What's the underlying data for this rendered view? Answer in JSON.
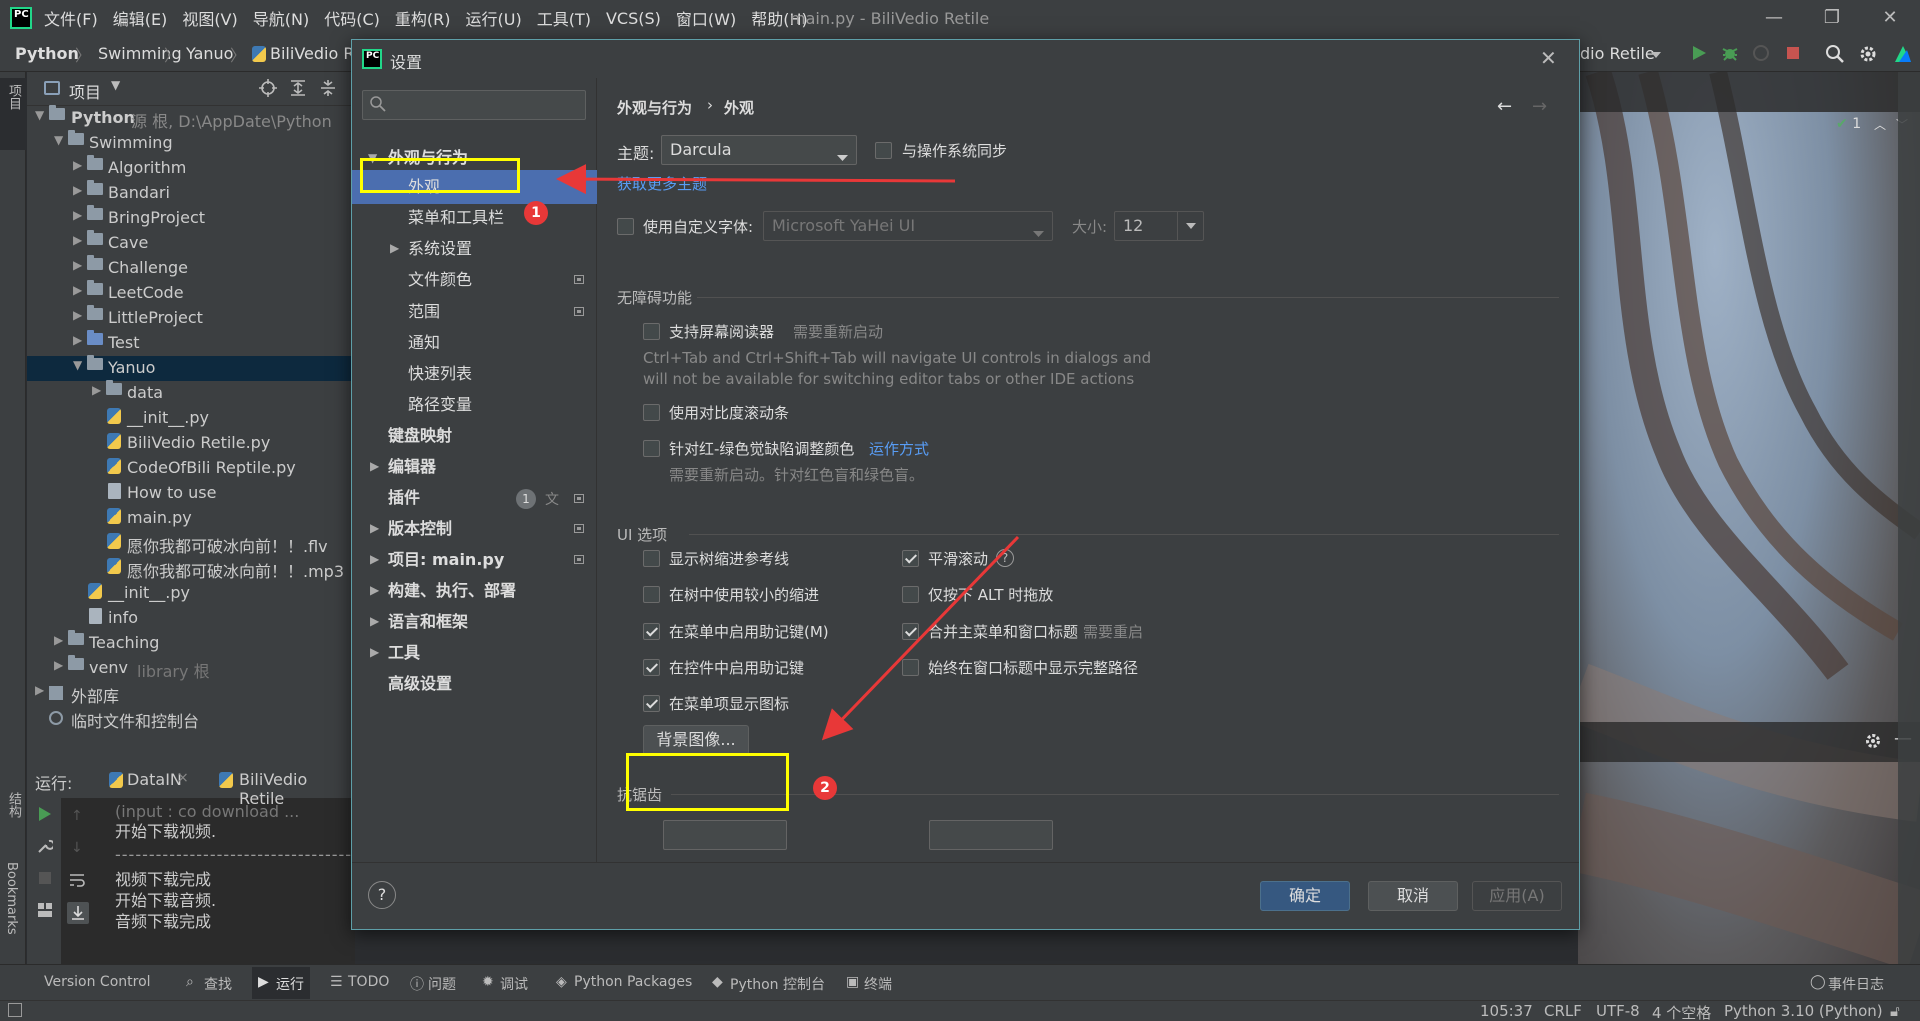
{
  "menubar": {
    "logo": "PC",
    "items": [
      "文件(F)",
      "编辑(E)",
      "视图(V)",
      "导航(N)",
      "代码(C)",
      "重构(R)",
      "运行(U)",
      "工具(T)",
      "VCS(S)",
      "窗口(W)",
      "帮助(H)"
    ],
    "title": "main.py - BiliVedio Retile"
  },
  "window_controls": {
    "minimize": "—",
    "restore": "❐",
    "close": "✕"
  },
  "breadcrumbs": [
    "Python",
    "Swimming",
    "Yanuo",
    "BiliVedio R"
  ],
  "run_config": "dio Retile",
  "left_tabs": {
    "project": "项目",
    "structure": "结构",
    "bookmarks": "Bookmarks"
  },
  "project": {
    "header": "项目",
    "tree": [
      {
        "label": "Python",
        "extra": "源 根, D:\\AppDate\\Python",
        "kind": "folder"
      },
      {
        "label": "Swimming",
        "kind": "folder"
      },
      {
        "label": "Algorithm",
        "kind": "folder"
      },
      {
        "label": "Bandari",
        "kind": "folder"
      },
      {
        "label": "BringProject",
        "kind": "folder"
      },
      {
        "label": "Cave",
        "kind": "folder"
      },
      {
        "label": "Challenge",
        "kind": "folder"
      },
      {
        "label": "LeetCode",
        "kind": "folder"
      },
      {
        "label": "LittleProject",
        "kind": "folder"
      },
      {
        "label": "Test",
        "kind": "folder"
      },
      {
        "label": "Yanuo",
        "kind": "folder"
      },
      {
        "label": "data",
        "kind": "folder"
      },
      {
        "label": "__init__.py",
        "kind": "py"
      },
      {
        "label": "BiliVedio Retile.py",
        "kind": "py"
      },
      {
        "label": "CodeOfBili Reptile.py",
        "kind": "py"
      },
      {
        "label": "How to use",
        "kind": "txt"
      },
      {
        "label": "main.py",
        "kind": "py"
      },
      {
        "label": "愿你我都可破冰向前！！.flv",
        "kind": "py"
      },
      {
        "label": "愿你我都可破冰向前！！.mp3",
        "kind": "py"
      },
      {
        "label": "__init__.py",
        "kind": "py"
      },
      {
        "label": "info",
        "kind": "txt"
      },
      {
        "label": "Teaching",
        "kind": "folder"
      },
      {
        "label": "venv",
        "extra": "library 根",
        "kind": "folder"
      },
      {
        "label": "外部库",
        "kind": "lib"
      },
      {
        "label": "临时文件和控制台",
        "kind": "scratch"
      }
    ]
  },
  "run": {
    "label": "运行:",
    "tabs": [
      "DataIN",
      "BiliVedio Retile"
    ],
    "lines": [
      "(input : co download ...",
      "开始下载视频.",
      "------------------------------------",
      "视频下载完成",
      "开始下载音频.",
      "音频下载完成"
    ]
  },
  "bottom_toolbar": [
    "Version Control",
    "查找",
    "运行",
    "TODO",
    "问题",
    "调试",
    "Python Packages",
    "Python 控制台",
    "终端",
    "事件日志"
  ],
  "statusbar": {
    "position": "105:37",
    "eol": "CRLF",
    "encoding": "UTF-8",
    "indent": "4 个空格",
    "interpreter": "Python 3.10 (Python)"
  },
  "inspection": {
    "count": "1"
  },
  "dialog": {
    "title": "设置",
    "search_placeholder": "",
    "nav": {
      "appearance_behavior": "外观与行为",
      "appearance": "外观",
      "menus_toolbars": "菜单和工具栏",
      "system_settings": "系统设置",
      "file_colors": "文件颜色",
      "scopes": "范围",
      "notifications": "通知",
      "quick_lists": "快速列表",
      "path_variables": "路径变量",
      "keymap": "键盘映射",
      "editor": "编辑器",
      "plugins": "插件",
      "plugins_badge": "1",
      "version_control": "版本控制",
      "project": "项目: main.py",
      "build": "构建、执行、部署",
      "languages": "语言和框架",
      "tools": "工具",
      "advanced": "高级设置"
    },
    "breadcrumb": {
      "parent": "外观与行为",
      "sep": "›",
      "current": "外观"
    },
    "theme": {
      "label": "主题:",
      "value": "Darcula",
      "sync_label": "与操作系统同步",
      "sync_checked": false,
      "more_link": "获取更多主题"
    },
    "font": {
      "use_custom_label": "使用自定义字体:",
      "checked": false,
      "value": "Microsoft YaHei UI",
      "size_label": "大小:",
      "size_value": "12"
    },
    "accessibility": {
      "header": "无障碍功能",
      "screen_reader": "支持屏幕阅读器",
      "screen_reader_note": "需要重新启动",
      "screen_reader_desc1": "Ctrl+Tab and Ctrl+Shift+Tab will navigate UI controls in dialogs and",
      "screen_reader_desc2": "will not be available for switching editor tabs or other IDE actions",
      "contrast_scroll": "使用对比度滚动条",
      "color_deficiency": "针对红-绿色觉缺陷调整颜色",
      "how_it_works": "运作方式",
      "color_note": "需要重新启动。针对红色盲和绿色盲。"
    },
    "ui_options": {
      "header": "UI 选项",
      "left": [
        {
          "label": "显示树缩进参考线",
          "checked": false
        },
        {
          "label": "在树中使用较小的缩进",
          "checked": false
        },
        {
          "label": "在菜单中启用助记键(M)",
          "checked": true
        },
        {
          "label": "在控件中启用助记键",
          "checked": true
        },
        {
          "label": "在菜单项显示图标",
          "checked": true
        }
      ],
      "right": [
        {
          "label": "平滑滚动",
          "checked": true
        },
        {
          "label": "仅按下 ALT 时拖放",
          "checked": false
        },
        {
          "label": "合并主菜单和窗口标题",
          "checked": true,
          "note": "需要重启"
        },
        {
          "label": "始终在窗口标题中显示完整路径",
          "checked": false
        }
      ],
      "background_button": "背景图像..."
    },
    "antialias_header": "抗锯齿",
    "buttons": {
      "ok": "确定",
      "cancel": "取消",
      "apply": "应用(A)",
      "help": "?"
    }
  },
  "annotations": {
    "badge1": "1",
    "badge2": "2",
    "highlight_color": "#ffff00",
    "arrow_color": "#e83838"
  },
  "colors": {
    "accent": "#4b6eaf",
    "link": "#589df6",
    "primary_button": "#365880"
  }
}
